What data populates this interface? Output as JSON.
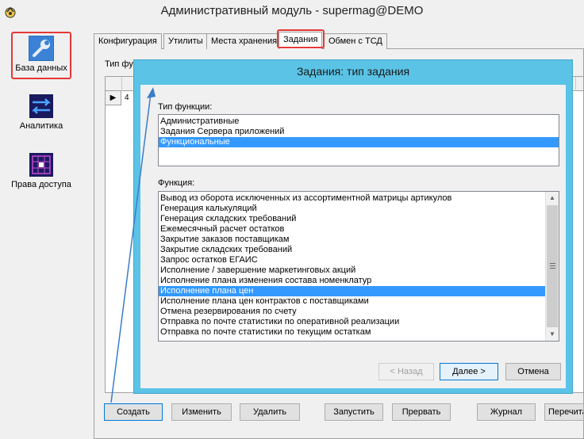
{
  "window": {
    "title": "Административный модуль - supermag@DEMO"
  },
  "nav": [
    {
      "label": "База данных"
    },
    {
      "label": "Аналитика"
    },
    {
      "label": "Права доступа"
    }
  ],
  "tabs": [
    "Конфигурация",
    "Утилиты",
    "Места хранения",
    "Задания",
    "Обмен с ТСД"
  ],
  "behind": {
    "filter_label": "Тип фу",
    "row_cell": "4"
  },
  "buttons": {
    "create": "Создать",
    "edit": "Изменить",
    "delete": "Удалить",
    "start": "Запустить",
    "interrupt": "Прервать",
    "log": "Журнал",
    "reread": "Перечита"
  },
  "dialog": {
    "title": "Задания: тип задания",
    "type_label": "Тип функции:",
    "types": [
      "Административные",
      "Задания Сервера приложений",
      "Функциональные"
    ],
    "function_label": "Функция:",
    "functions": [
      "Вывод из оборота исключенных из ассортиментной матрицы артикулов",
      "Генерация калькуляций",
      "Генерация складских требований",
      "Ежемесячный расчет остатков",
      "Закрытие заказов поставщикам",
      "Закрытие складских требований",
      "Запрос остатков ЕГАИС",
      "Исполнение / завершение маркетинговых акций",
      "Исполнение плана изменения состава номенклатур",
      "Исполнение плана цен",
      "Исполнение плана цен контрактов с поставщиками",
      "Отмена резервирования по счету",
      "Отправка по почте статистики по оперативной реализации",
      "Отправка по почте статистики по текущим остаткам"
    ],
    "selected_type": 2,
    "selected_function": 9,
    "back_button": "< Назад",
    "next_button": "Далее >",
    "cancel_button": "Отмена"
  },
  "colors": {
    "dialog_frame": "#5ac3e6",
    "selection": "#3399ff",
    "highlight": "#e53935",
    "arrow": "#3a7dc9"
  }
}
